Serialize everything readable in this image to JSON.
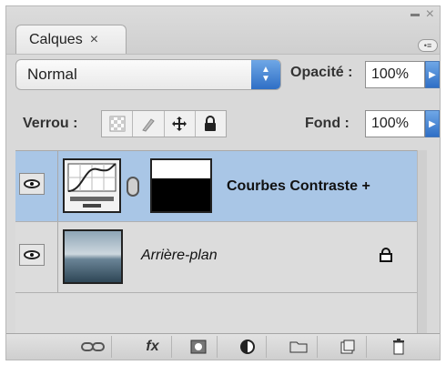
{
  "panel": {
    "tab_label": "Calques",
    "tab_close": "×",
    "window_close": "×",
    "flyout_glyph": "•≡"
  },
  "blend": {
    "mode": "Normal",
    "opacity_label": "Opacité :",
    "opacity_value": "100%"
  },
  "lock": {
    "label": "Verrou :",
    "fill_label": "Fond :",
    "fill_value": "100%",
    "icons": [
      "lock-transparent-icon",
      "lock-image-icon",
      "lock-position-icon",
      "lock-all-icon"
    ]
  },
  "layers": [
    {
      "name": "Courbes Contraste +",
      "selected": true,
      "visible": true
    },
    {
      "name": "Arrière-plan",
      "selected": false,
      "visible": true,
      "locked": true
    }
  ],
  "bottom_bar": {
    "buttons": [
      "link-layers-icon",
      "fx-icon",
      "layer-mask-icon",
      "adjustment-layer-icon",
      "new-group-icon",
      "new-layer-icon",
      "trash-icon"
    ],
    "fx_label": "fx"
  }
}
